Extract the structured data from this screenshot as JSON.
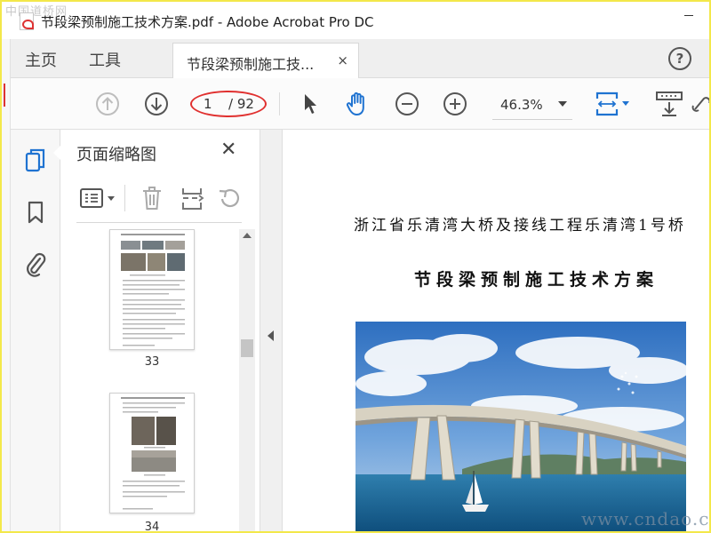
{
  "window": {
    "title": "节段梁预制施工技术方案.pdf - Adobe Acrobat Pro DC",
    "watermark_logo": "中国道桥网"
  },
  "tabs": {
    "home": "主页",
    "tools": "工具",
    "document_tab": "节段梁预制施工技...",
    "document_tab_close": "×"
  },
  "toolbar": {
    "page_current": "1",
    "page_total": "/ 92",
    "zoom": "46.3%"
  },
  "thumbnails_pane": {
    "title": "页面缩略图",
    "close": "✕",
    "pages": [
      {
        "label": "33"
      },
      {
        "label": "34"
      }
    ]
  },
  "document": {
    "heading_line1": "浙江省乐清湾大桥及接线工程乐清湾1号桥",
    "heading_line2": "节段梁预制施工技术方案"
  },
  "site_watermark": "www.cndao.com",
  "colors": {
    "accent_blue": "#1f73d1",
    "highlight_red": "#e0302f",
    "outer_border": "#f3e84a"
  }
}
